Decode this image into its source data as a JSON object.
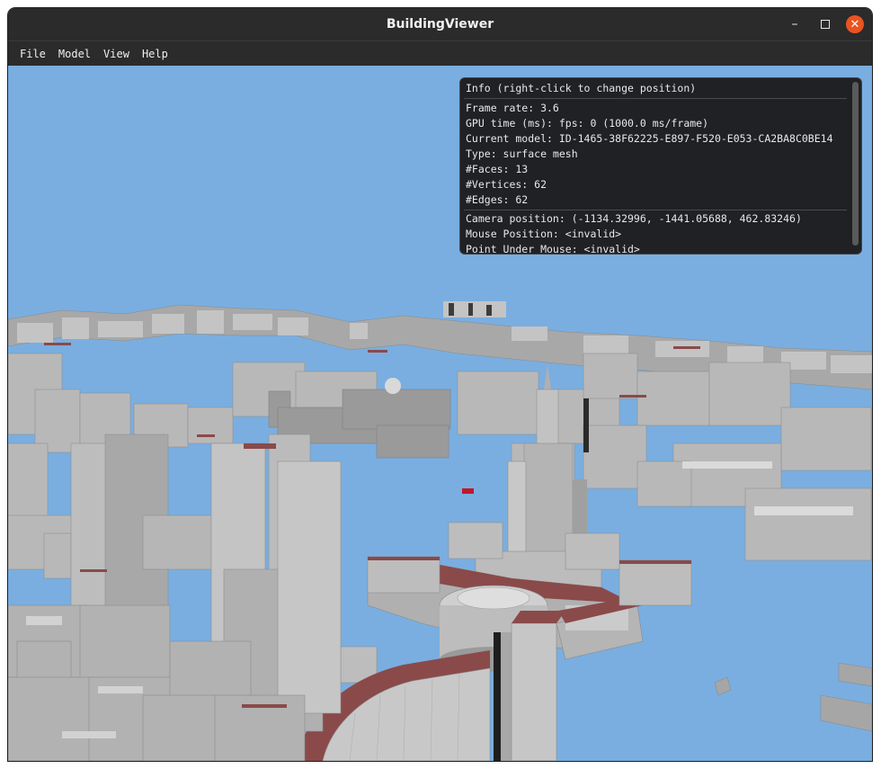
{
  "window": {
    "title": "BuildingViewer",
    "close_glyph": "✕",
    "minimize_glyph": "–"
  },
  "menu": [
    {
      "label": "File"
    },
    {
      "label": "Model"
    },
    {
      "label": "View"
    },
    {
      "label": "Help"
    }
  ],
  "info_panel": {
    "header": "Info (right-click to change position)",
    "stats": [
      "Frame rate: 3.6",
      "GPU time (ms): fps:  0 (1000.0 ms/frame)",
      "Current model: ID-1465-38F62225-E897-F520-E053-CA2BA8C0BE14",
      "Type: surface mesh",
      "#Faces: 13",
      "#Vertices: 62",
      "#Edges: 62"
    ],
    "camera": [
      "Camera position: (-1134.32996, -1441.05688, 462.83246)",
      "Mouse Position: <invalid>",
      "Point Under Mouse: <invalid>"
    ]
  },
  "colors": {
    "sky": "#7aaee0",
    "building_light": "#bdbdbd",
    "building_mid": "#9c9c9c",
    "building_dark": "#7a7a7a",
    "roof_highlight": "#8a4a4a",
    "selected": "#c0182a",
    "titlebar": "#2b2b2b",
    "close_button": "#e95420"
  }
}
